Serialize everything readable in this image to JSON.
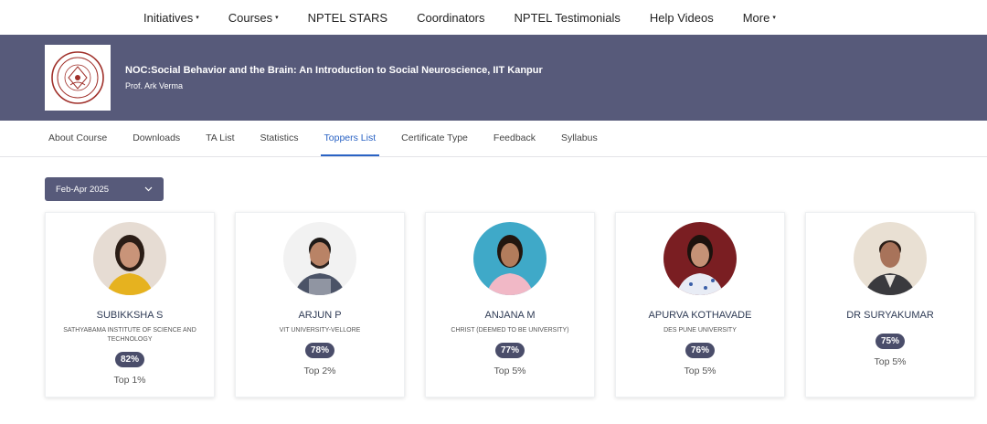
{
  "topnav": {
    "items": [
      {
        "label": "Initiatives",
        "has_caret": true
      },
      {
        "label": "Courses",
        "has_caret": true
      },
      {
        "label": "NPTEL STARS",
        "has_caret": false
      },
      {
        "label": "Coordinators",
        "has_caret": false
      },
      {
        "label": "NPTEL Testimonials",
        "has_caret": false
      },
      {
        "label": "Help Videos",
        "has_caret": false
      },
      {
        "label": "More",
        "has_caret": true
      }
    ],
    "caret": "▾"
  },
  "course": {
    "title": "NOC:Social Behavior and the Brain: An Introduction to Social Neuroscience, IIT Kanpur",
    "professor": "Prof. Ark Verma",
    "logo_icon": "iit-kanpur-seal"
  },
  "tabs": [
    {
      "label": "About Course",
      "active": false
    },
    {
      "label": "Downloads",
      "active": false
    },
    {
      "label": "TA List",
      "active": false
    },
    {
      "label": "Statistics",
      "active": false
    },
    {
      "label": "Toppers List",
      "active": true
    },
    {
      "label": "Certificate Type",
      "active": false
    },
    {
      "label": "Feedback",
      "active": false
    },
    {
      "label": "Syllabus",
      "active": false
    }
  ],
  "term_select": {
    "value": "Feb-Apr 2025",
    "icon": "chevron-down-icon"
  },
  "toppers": [
    {
      "name": "SUBIKKSHA S",
      "institution": "SATHYABAMA INSTITUTE OF SCIENCE AND TECHNOLOGY",
      "score": "82%",
      "rank": "Top 1%"
    },
    {
      "name": "ARJUN P",
      "institution": "VIT UNIVERSITY-VELLORE",
      "score": "78%",
      "rank": "Top 2%"
    },
    {
      "name": "ANJANA M",
      "institution": "CHRIST (DEEMED TO BE UNIVERSITY)",
      "score": "77%",
      "rank": "Top 5%"
    },
    {
      "name": "APURVA KOTHAVADE",
      "institution": "DES PUNE UNIVERSITY",
      "score": "76%",
      "rank": "Top 5%"
    },
    {
      "name": "DR SURYAKUMAR",
      "institution": "",
      "score": "75%",
      "rank": "Top 5%"
    }
  ],
  "colors": {
    "banner": "#575a7a",
    "accent": "#2a63c4",
    "score_badge": "#4a4d6a"
  }
}
